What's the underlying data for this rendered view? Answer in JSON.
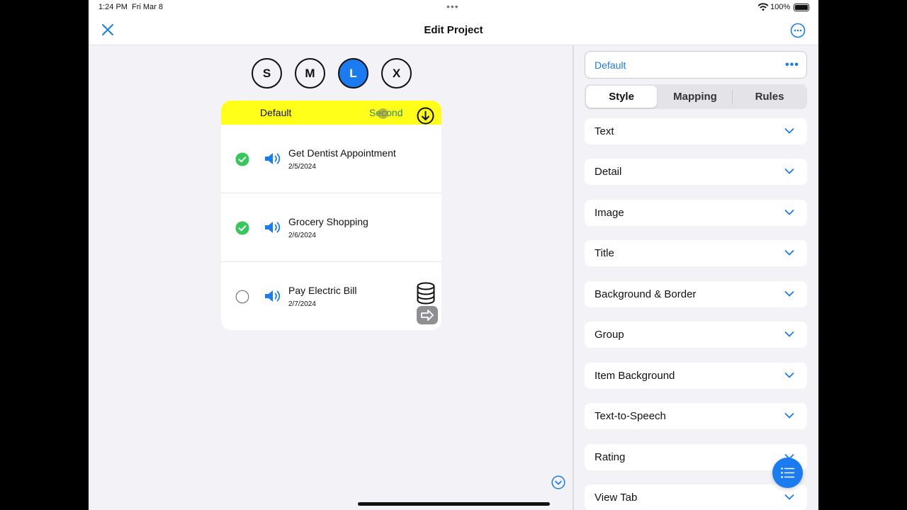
{
  "status_bar": {
    "time": "1:24 PM",
    "date": "Fri Mar 8",
    "battery": "100%"
  },
  "nav": {
    "title": "Edit Project",
    "close_icon": "close-icon",
    "more_icon": "more-circle-icon"
  },
  "sizes": [
    {
      "label": "S",
      "active": false
    },
    {
      "label": "M",
      "active": false
    },
    {
      "label": "L",
      "active": true
    },
    {
      "label": "X",
      "active": false
    }
  ],
  "card": {
    "tabs": {
      "first": "Default",
      "second": "Second"
    },
    "items": [
      {
        "title": "Get Dentist Appointment",
        "date": "2/5/2024",
        "done": true
      },
      {
        "title": "Grocery Shopping",
        "date": "2/6/2024",
        "done": true
      },
      {
        "title": "Pay Electric Bill",
        "date": "2/7/2024",
        "done": false
      }
    ]
  },
  "panel": {
    "preset_name": "Default",
    "segments": [
      "Style",
      "Mapping",
      "Rules"
    ],
    "active_segment": "Style",
    "sections": [
      "Text",
      "Detail",
      "Image",
      "Title",
      "Background & Border",
      "Group",
      "Item Background",
      "Text-to-Speech",
      "Rating",
      "View Tab"
    ]
  },
  "colors": {
    "accent": "#1a7cf0",
    "tab_bar": "#ffff1a",
    "check": "#34c759"
  }
}
